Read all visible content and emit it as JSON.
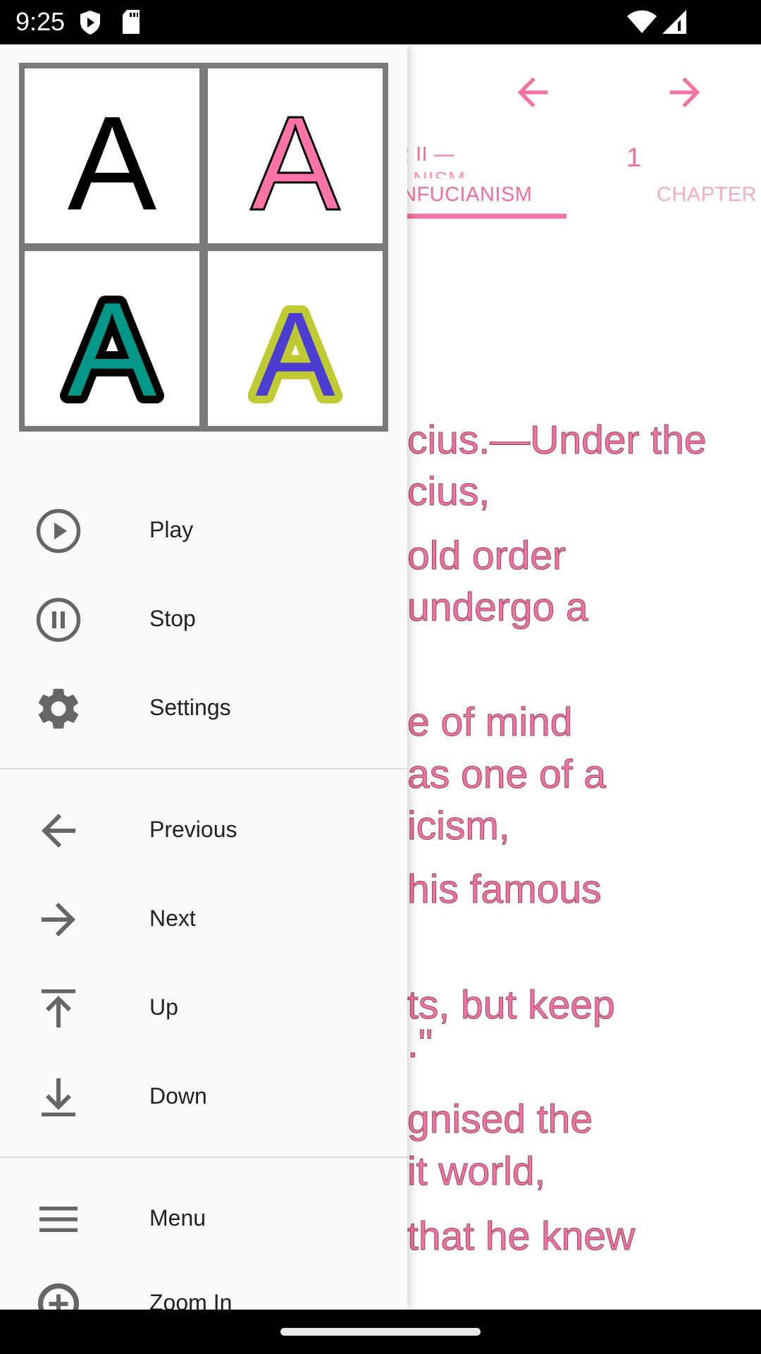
{
  "status_bar": {
    "time": "9:25",
    "icons": [
      "shield-play-icon",
      "sd-card-icon",
      "wifi-icon",
      "signal-icon"
    ]
  },
  "reader": {
    "prev_icon": "arrow-left-icon",
    "next_icon": "arrow-right-icon",
    "tabs": [
      {
        "label_top": "R II —",
        "label_mid": "NISM",
        "label": "NFUCIANISM",
        "active": true
      },
      {
        "label_top": "1",
        "label": "CHAPTER",
        "active": false
      }
    ],
    "lines": [
      "cius.—Under the",
      "cius,",
      "old order",
      "undergo a",
      "e of mind",
      "as one of a",
      "icism,",
      "his famous",
      "ts, but keep",
      ".\"",
      "gnised the",
      "it world,",
      "that he knew"
    ],
    "accent": "#f06e9e"
  },
  "drawer": {
    "style_samples": [
      "A",
      "A",
      "A",
      "A"
    ],
    "group1": [
      {
        "label": "Play",
        "icon": "play-circle-icon"
      },
      {
        "label": "Stop",
        "icon": "pause-circle-icon"
      },
      {
        "label": "Settings",
        "icon": "gear-icon"
      }
    ],
    "group2": [
      {
        "label": "Previous",
        "icon": "arrow-left-icon"
      },
      {
        "label": "Next",
        "icon": "arrow-right-icon"
      },
      {
        "label": "Up",
        "icon": "arrow-up-to-top-icon"
      },
      {
        "label": "Down",
        "icon": "arrow-down-to-bottom-icon"
      }
    ],
    "group3": [
      {
        "label": "Menu",
        "icon": "menu-icon"
      },
      {
        "label": "Zoom In",
        "icon": "zoom-in-icon"
      }
    ]
  }
}
